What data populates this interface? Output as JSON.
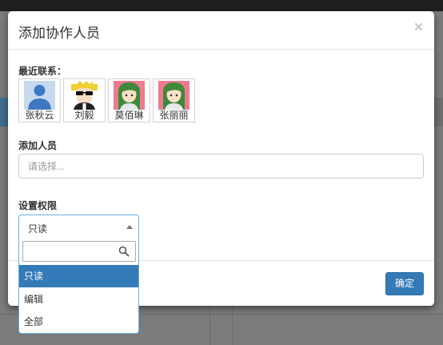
{
  "modal": {
    "title": "添加协作人员",
    "close_glyph": "×",
    "recent_label": "最近联系：",
    "add_label": "添加人员",
    "add_placeholder": "请选择...",
    "permission_label": "设置权限",
    "confirm_label": "确定"
  },
  "contacts": [
    {
      "name": "张秋云",
      "avatar": "default-user-avatar"
    },
    {
      "name": "刘毅",
      "avatar": "sunglasses-avatar"
    },
    {
      "name": "莫佰琳",
      "avatar": "girl-avatar"
    },
    {
      "name": "张丽丽",
      "avatar": "girl-avatar"
    }
  ],
  "permission_select": {
    "value": "只读",
    "options": [
      "只读",
      "编辑",
      "全部"
    ],
    "selected_index": 0,
    "search_value": ""
  },
  "colors": {
    "primary": "#337ab7",
    "focus_border": "#66afe9",
    "overlay": "#7b7b7b"
  }
}
